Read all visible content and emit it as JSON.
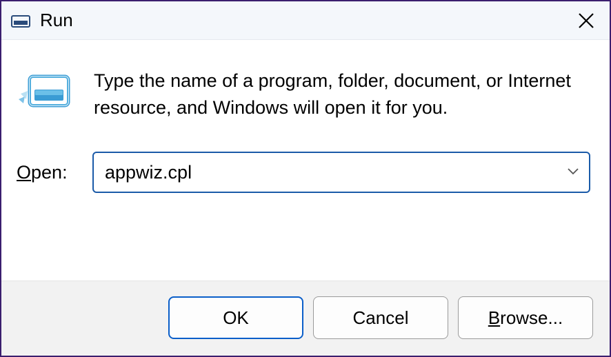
{
  "titlebar": {
    "title": "Run"
  },
  "content": {
    "info_text": "Type the name of a program, folder, document, or Internet resource, and Windows will open it for you.",
    "open_label_prefix": "O",
    "open_label_rest": "pen:",
    "combo_value": "appwiz.cpl"
  },
  "footer": {
    "ok_label": "OK",
    "cancel_label": "Cancel",
    "browse_prefix": "B",
    "browse_rest": "rowse..."
  }
}
